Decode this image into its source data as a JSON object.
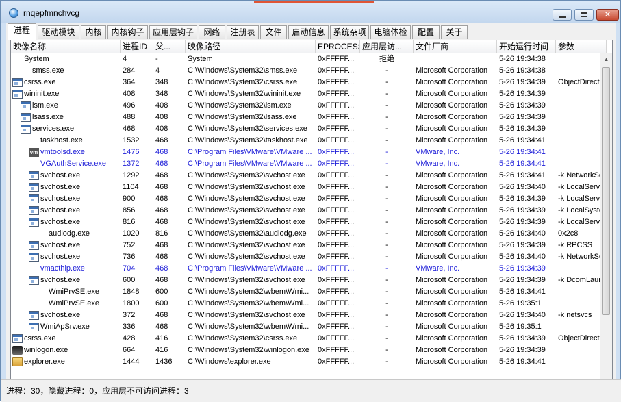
{
  "window": {
    "title": "rnqepfmnchvcg"
  },
  "tabs": [
    "进程",
    "驱动模块",
    "内核",
    "内核钩子",
    "应用层钩子",
    "网络",
    "注册表",
    "文件",
    "启动信息",
    "系统杂项",
    "电脑体检",
    "配置",
    "关于"
  ],
  "columns": [
    "映像名称",
    "进程ID",
    "父...",
    "映像路径",
    "EPROCESS",
    "应用层访...",
    "文件厂商",
    "开始运行时间",
    "参数"
  ],
  "rows": [
    {
      "name": "System",
      "pid": "4",
      "ppid": "-",
      "path": "System",
      "eprocess": "0xFFFFF...",
      "access": "拒绝",
      "vendor": "",
      "time": "5-26 19:34:38",
      "args": ""
    },
    {
      "name": "smss.exe",
      "pid": "284",
      "ppid": "4",
      "path": "C:\\Windows\\System32\\smss.exe",
      "eprocess": "0xFFFFF...",
      "access": "-",
      "vendor": "Microsoft Corporation",
      "time": "5-26 19:34:38",
      "args": ""
    },
    {
      "name": "csrss.exe",
      "pid": "364",
      "ppid": "348",
      "path": "C:\\Windows\\System32\\csrss.exe",
      "eprocess": "0xFFFFF...",
      "access": "-",
      "vendor": "Microsoft Corporation",
      "time": "5-26 19:34:39",
      "args": "ObjectDirector..."
    },
    {
      "name": "wininit.exe",
      "pid": "408",
      "ppid": "348",
      "path": "C:\\Windows\\System32\\wininit.exe",
      "eprocess": "0xFFFFF...",
      "access": "-",
      "vendor": "Microsoft Corporation",
      "time": "5-26 19:34:39",
      "args": ""
    },
    {
      "name": "lsm.exe",
      "pid": "496",
      "ppid": "408",
      "path": "C:\\Windows\\System32\\lsm.exe",
      "eprocess": "0xFFFFF...",
      "access": "-",
      "vendor": "Microsoft Corporation",
      "time": "5-26 19:34:39",
      "args": ""
    },
    {
      "name": "lsass.exe",
      "pid": "488",
      "ppid": "408",
      "path": "C:\\Windows\\System32\\lsass.exe",
      "eprocess": "0xFFFFF...",
      "access": "-",
      "vendor": "Microsoft Corporation",
      "time": "5-26 19:34:39",
      "args": ""
    },
    {
      "name": "services.exe",
      "pid": "468",
      "ppid": "408",
      "path": "C:\\Windows\\System32\\services.exe",
      "eprocess": "0xFFFFF...",
      "access": "-",
      "vendor": "Microsoft Corporation",
      "time": "5-26 19:34:39",
      "args": ""
    },
    {
      "name": "taskhost.exe",
      "pid": "1532",
      "ppid": "468",
      "path": "C:\\Windows\\System32\\taskhost.exe",
      "eprocess": "0xFFFFF...",
      "access": "-",
      "vendor": "Microsoft Corporation",
      "time": "5-26 19:34:41",
      "args": ""
    },
    {
      "name": "vmtoolsd.exe",
      "pid": "1476",
      "ppid": "468",
      "path": "C:\\Program Files\\VMware\\VMware ...",
      "eprocess": "0xFFFFF...",
      "access": "-",
      "vendor": "VMware, Inc.",
      "time": "5-26 19:34:41",
      "args": ""
    },
    {
      "name": "VGAuthService.exe",
      "pid": "1372",
      "ppid": "468",
      "path": "C:\\Program Files\\VMware\\VMware ...",
      "eprocess": "0xFFFFF...",
      "access": "-",
      "vendor": "VMware, Inc.",
      "time": "5-26 19:34:41",
      "args": ""
    },
    {
      "name": "svchost.exe",
      "pid": "1292",
      "ppid": "468",
      "path": "C:\\Windows\\System32\\svchost.exe",
      "eprocess": "0xFFFFF...",
      "access": "-",
      "vendor": "Microsoft Corporation",
      "time": "5-26 19:34:41",
      "args": "-k NetworkSer..."
    },
    {
      "name": "svchost.exe",
      "pid": "1104",
      "ppid": "468",
      "path": "C:\\Windows\\System32\\svchost.exe",
      "eprocess": "0xFFFFF...",
      "access": "-",
      "vendor": "Microsoft Corporation",
      "time": "5-26 19:34:40",
      "args": "-k LocalService..."
    },
    {
      "name": "svchost.exe",
      "pid": "900",
      "ppid": "468",
      "path": "C:\\Windows\\System32\\svchost.exe",
      "eprocess": "0xFFFFF...",
      "access": "-",
      "vendor": "Microsoft Corporation",
      "time": "5-26 19:34:39",
      "args": "-k LocalService"
    },
    {
      "name": "svchost.exe",
      "pid": "856",
      "ppid": "468",
      "path": "C:\\Windows\\System32\\svchost.exe",
      "eprocess": "0xFFFFF...",
      "access": "-",
      "vendor": "Microsoft Corporation",
      "time": "5-26 19:34:39",
      "args": "-k LocalSystem..."
    },
    {
      "name": "svchost.exe",
      "pid": "816",
      "ppid": "468",
      "path": "C:\\Windows\\System32\\svchost.exe",
      "eprocess": "0xFFFFF...",
      "access": "-",
      "vendor": "Microsoft Corporation",
      "time": "5-26 19:34:39",
      "args": "-k LocalService..."
    },
    {
      "name": "audiodg.exe",
      "pid": "1020",
      "ppid": "816",
      "path": "C:\\Windows\\System32\\audiodg.exe",
      "eprocess": "0xFFFFF...",
      "access": "-",
      "vendor": "Microsoft Corporation",
      "time": "5-26 19:34:40",
      "args": "0x2c8"
    },
    {
      "name": "svchost.exe",
      "pid": "752",
      "ppid": "468",
      "path": "C:\\Windows\\System32\\svchost.exe",
      "eprocess": "0xFFFFF...",
      "access": "-",
      "vendor": "Microsoft Corporation",
      "time": "5-26 19:34:39",
      "args": "-k RPCSS"
    },
    {
      "name": "svchost.exe",
      "pid": "736",
      "ppid": "468",
      "path": "C:\\Windows\\System32\\svchost.exe",
      "eprocess": "0xFFFFF...",
      "access": "-",
      "vendor": "Microsoft Corporation",
      "time": "5-26 19:34:40",
      "args": "-k NetworkSer..."
    },
    {
      "name": "vmacthlp.exe",
      "pid": "704",
      "ppid": "468",
      "path": "C:\\Program Files\\VMware\\VMware ...",
      "eprocess": "0xFFFFF...",
      "access": "-",
      "vendor": "VMware, Inc.",
      "time": "5-26 19:34:39",
      "args": ""
    },
    {
      "name": "svchost.exe",
      "pid": "600",
      "ppid": "468",
      "path": "C:\\Windows\\System32\\svchost.exe",
      "eprocess": "0xFFFFF...",
      "access": "-",
      "vendor": "Microsoft Corporation",
      "time": "5-26 19:34:39",
      "args": "-k DcomLaunch"
    },
    {
      "name": "WmiPrvSE.exe",
      "pid": "1848",
      "ppid": "600",
      "path": "C:\\Windows\\System32\\wbem\\Wmi...",
      "eprocess": "0xFFFFF...",
      "access": "-",
      "vendor": "Microsoft Corporation",
      "time": "5-26 19:34:41",
      "args": ""
    },
    {
      "name": "WmiPrvSE.exe",
      "pid": "1800",
      "ppid": "600",
      "path": "C:\\Windows\\System32\\wbem\\Wmi...",
      "eprocess": "0xFFFFF...",
      "access": "-",
      "vendor": "Microsoft Corporation",
      "time": "5-26 19:35:1",
      "args": ""
    },
    {
      "name": "svchost.exe",
      "pid": "372",
      "ppid": "468",
      "path": "C:\\Windows\\System32\\svchost.exe",
      "eprocess": "0xFFFFF...",
      "access": "-",
      "vendor": "Microsoft Corporation",
      "time": "5-26 19:34:40",
      "args": "-k netsvcs"
    },
    {
      "name": "WmiApSrv.exe",
      "pid": "336",
      "ppid": "468",
      "path": "C:\\Windows\\System32\\wbem\\Wmi...",
      "eprocess": "0xFFFFF...",
      "access": "-",
      "vendor": "Microsoft Corporation",
      "time": "5-26 19:35:1",
      "args": ""
    },
    {
      "name": "csrss.exe",
      "pid": "428",
      "ppid": "416",
      "path": "C:\\Windows\\System32\\csrss.exe",
      "eprocess": "0xFFFFF...",
      "access": "-",
      "vendor": "Microsoft Corporation",
      "time": "5-26 19:34:39",
      "args": "ObjectDirector..."
    },
    {
      "name": "winlogon.exe",
      "pid": "664",
      "ppid": "416",
      "path": "C:\\Windows\\System32\\winlogon.exe",
      "eprocess": "0xFFFFF...",
      "access": "-",
      "vendor": "Microsoft Corporation",
      "time": "5-26 19:34:39",
      "args": ""
    },
    {
      "name": "explorer.exe",
      "pid": "1444",
      "ppid": "1436",
      "path": "C:\\Windows\\explorer.exe",
      "eprocess": "0xFFFFF...",
      "access": "-",
      "vendor": "Microsoft Corporation",
      "time": "5-26 19:34:41",
      "args": ""
    }
  ],
  "status": "进程：30，隐藏进程：0，应用层不可访问进程：3",
  "colors": {
    "vmware_text": "#1c1cd8",
    "normal_text": "#000000",
    "accent": "#e05535"
  }
}
